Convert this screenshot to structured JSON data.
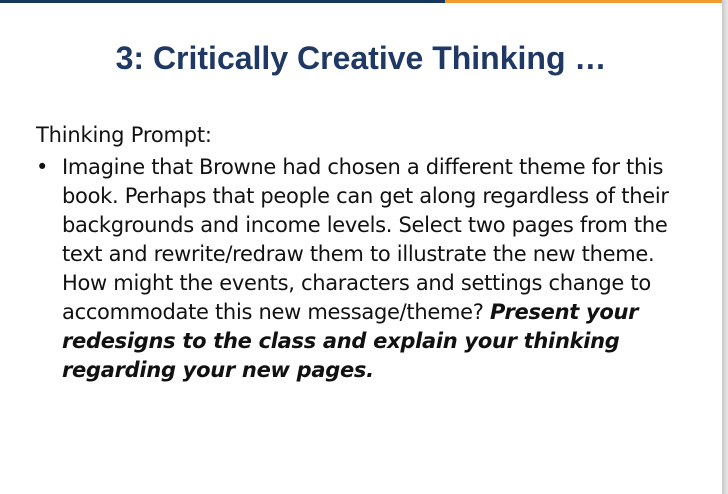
{
  "slide": {
    "title": "3: Critically Creative Thinking …",
    "prompt_label": "Thinking Prompt:",
    "bullet_symbol": "•",
    "bullet_text": "Imagine that Browne had chosen a different theme for this book. Perhaps that people can get along regardless of their backgrounds and income levels. Select two pages from the text and rewrite/redraw them to illustrate the new theme. How might the events, characters and settings change to accommodate this new message/theme?",
    "bullet_emphasis": "Present your redesigns to the class and explain your thinking regarding your new pages."
  },
  "colors": {
    "title": "#1f3864",
    "top_bar_blue": "#17365d",
    "top_bar_orange": "#f29a2e",
    "body_text": "#111111"
  }
}
